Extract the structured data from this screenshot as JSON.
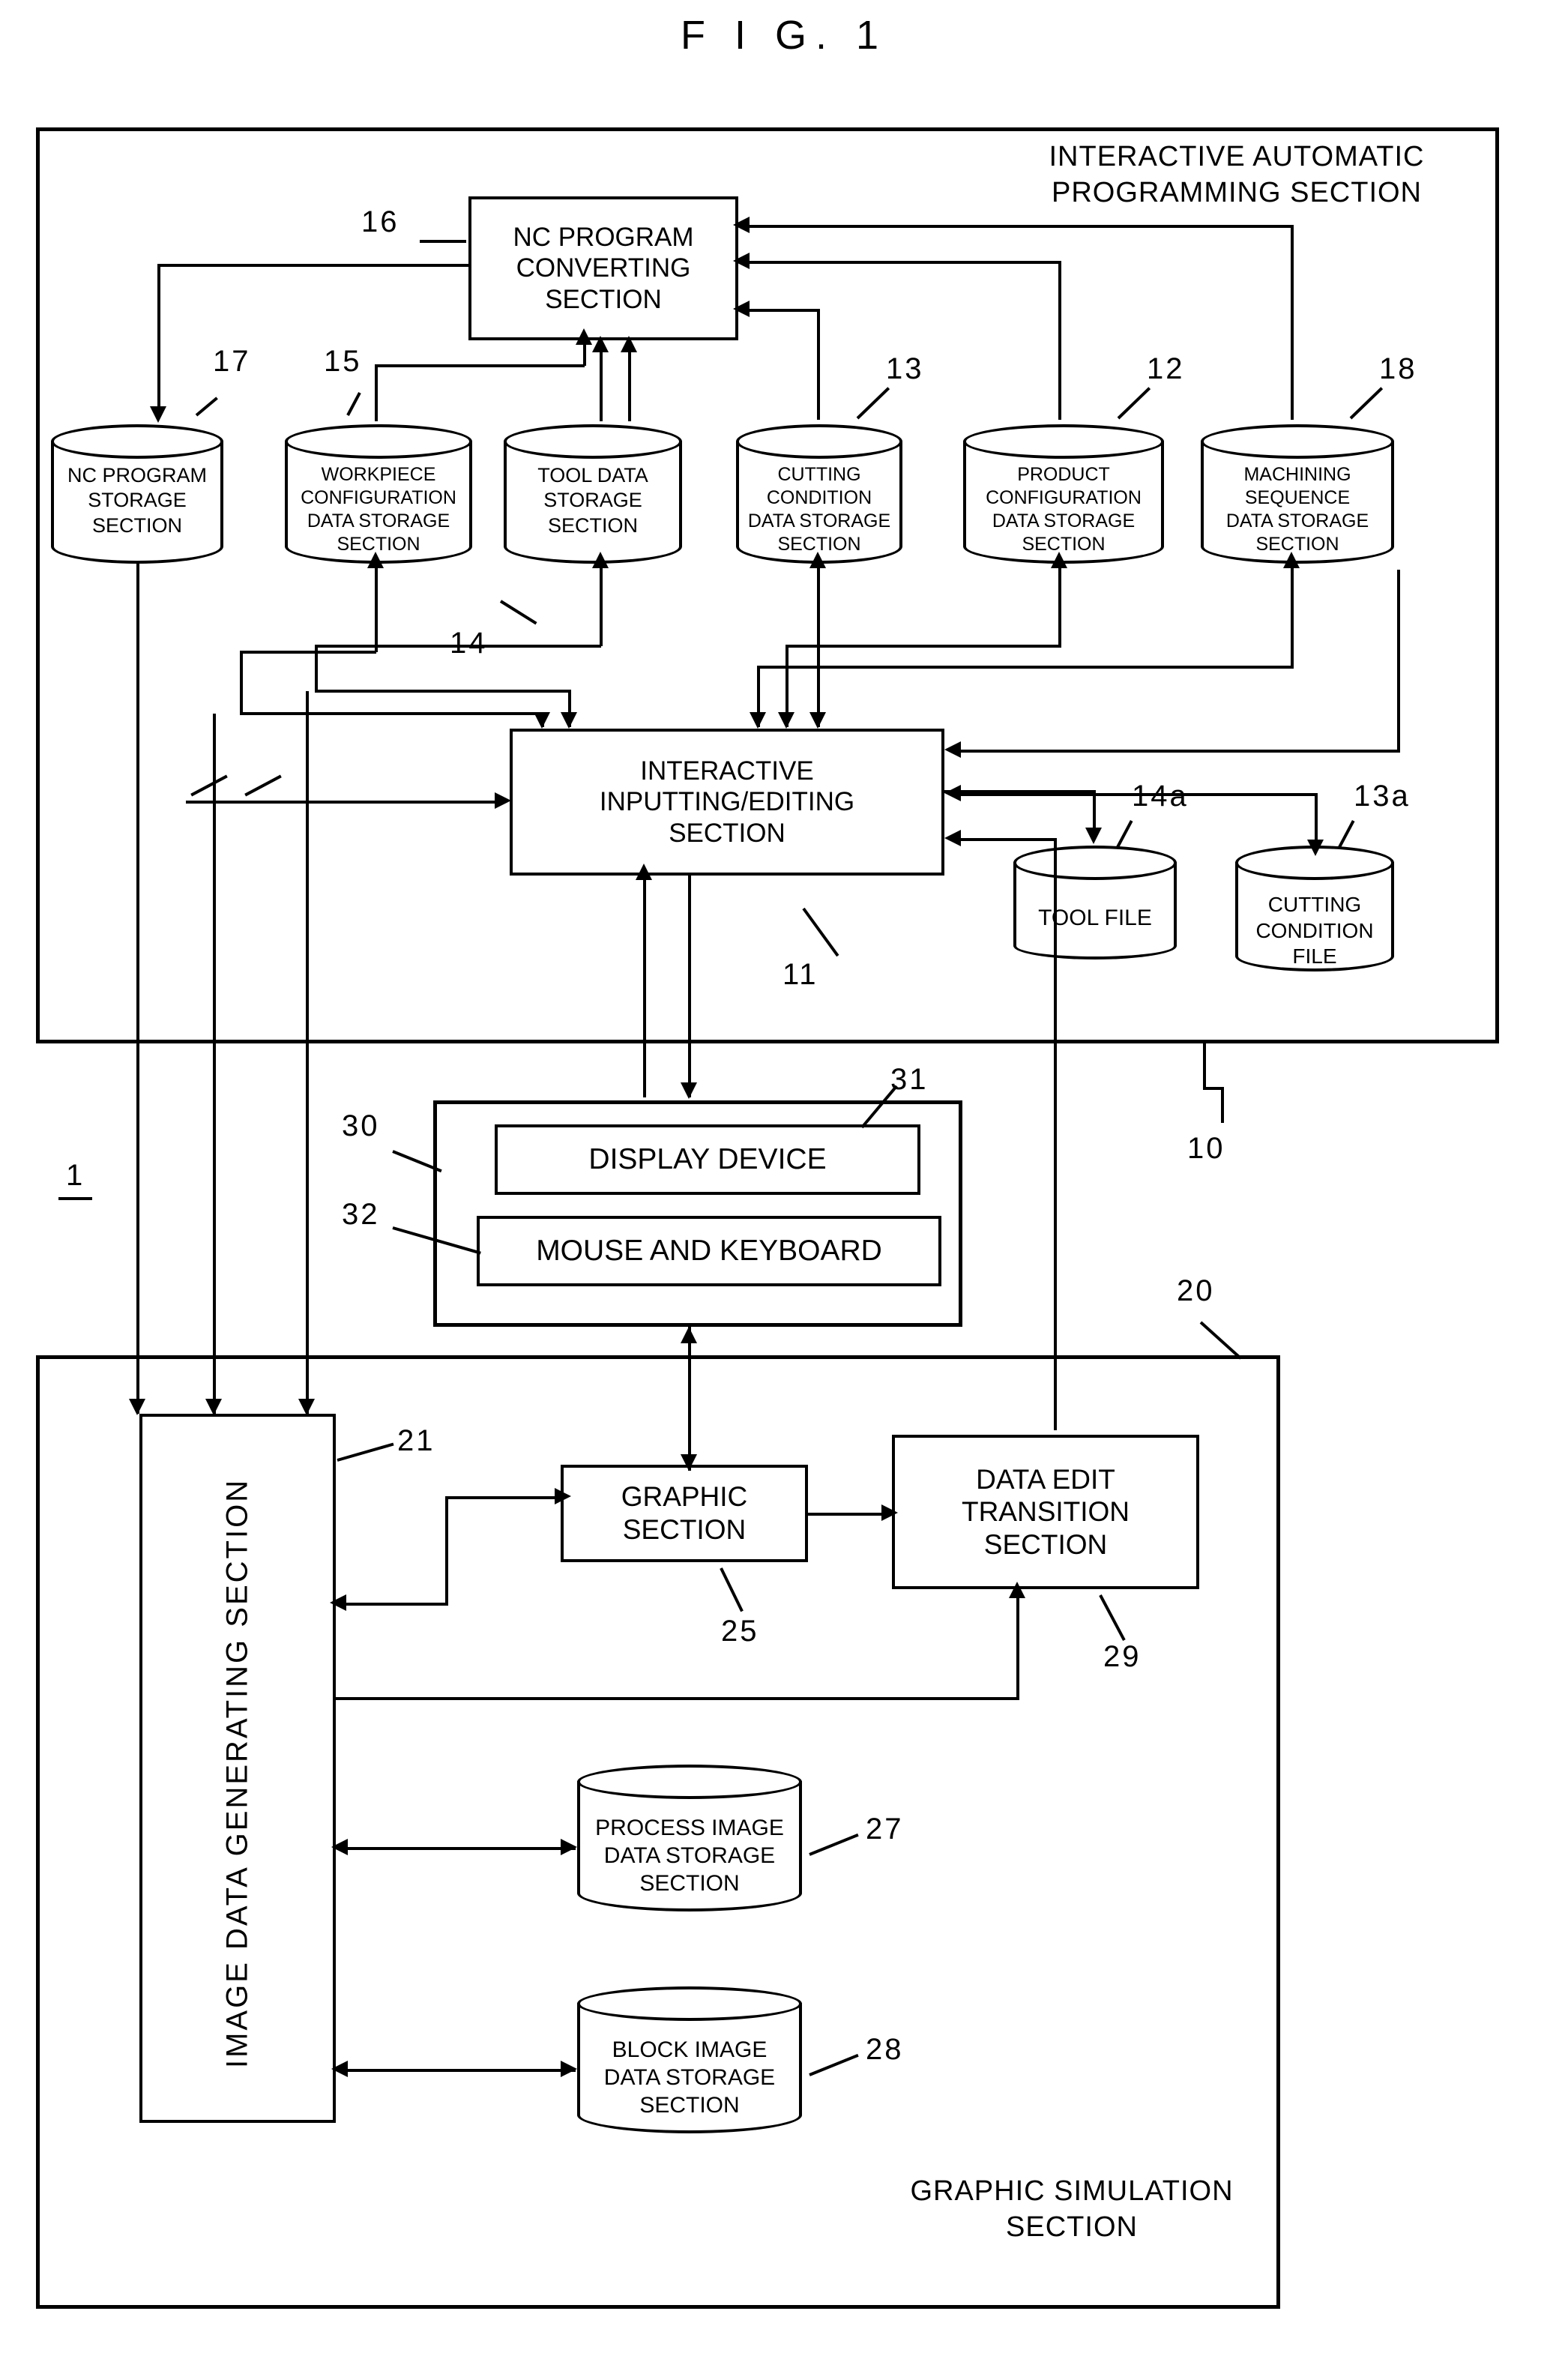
{
  "figure": {
    "title": "F I G.  1",
    "system_ref": "1"
  },
  "sections": {
    "interactive_automatic_programming": {
      "label": "INTERACTIVE AUTOMATIC\nPROGRAMMING SECTION",
      "ref": "10"
    },
    "graphic_simulation": {
      "label": "GRAPHIC SIMULATION\nSECTION",
      "ref": "20"
    }
  },
  "blocks": {
    "nc_program_converting": {
      "label": "NC PROGRAM\nCONVERTING\nSECTION",
      "ref": "16"
    },
    "interactive_inputting_editing": {
      "label": "INTERACTIVE\nINPUTTING/EDITING\nSECTION",
      "ref": "11"
    },
    "display_device": {
      "label": "DISPLAY DEVICE",
      "ref": "31"
    },
    "mouse_and_keyboard": {
      "label": "MOUSE AND KEYBOARD",
      "ref": "32"
    },
    "io_group": {
      "ref": "30"
    },
    "image_data_generating": {
      "label": "IMAGE DATA GENERATING SECTION",
      "ref": "21"
    },
    "graphic_section": {
      "label": "GRAPHIC\nSECTION",
      "ref": "25"
    },
    "data_edit_transition": {
      "label": "DATA EDIT\nTRANSITION\nSECTION",
      "ref": "29"
    }
  },
  "stores": {
    "nc_program_storage": {
      "label": "NC PROGRAM\nSTORAGE\nSECTION",
      "ref": "17"
    },
    "workpiece_configuration": {
      "label": "WORKPIECE\nCONFIGURATION\nDATA STORAGE\nSECTION",
      "ref": "15"
    },
    "tool_data_storage": {
      "label": "TOOL DATA\nSTORAGE\nSECTION",
      "ref": "14"
    },
    "cutting_condition_storage": {
      "label": "CUTTING\nCONDITION\nDATA STORAGE\nSECTION",
      "ref": "13"
    },
    "product_configuration": {
      "label": "PRODUCT\nCONFIGURATION\nDATA STORAGE\nSECTION",
      "ref": "12"
    },
    "machining_sequence": {
      "label": "MACHINING\nSEQUENCE\nDATA STORAGE\nSECTION",
      "ref": "18"
    },
    "tool_file": {
      "label": "TOOL FILE",
      "ref": "14a"
    },
    "cutting_condition_file": {
      "label": "CUTTING\nCONDITION\nFILE",
      "ref": "13a"
    },
    "process_image_storage": {
      "label": "PROCESS IMAGE\nDATA STORAGE\nSECTION",
      "ref": "27"
    },
    "block_image_storage": {
      "label": "BLOCK IMAGE\nDATA STORAGE\nSECTION",
      "ref": "28"
    }
  },
  "colors": {
    "ink": "#000000",
    "paper": "#ffffff"
  }
}
